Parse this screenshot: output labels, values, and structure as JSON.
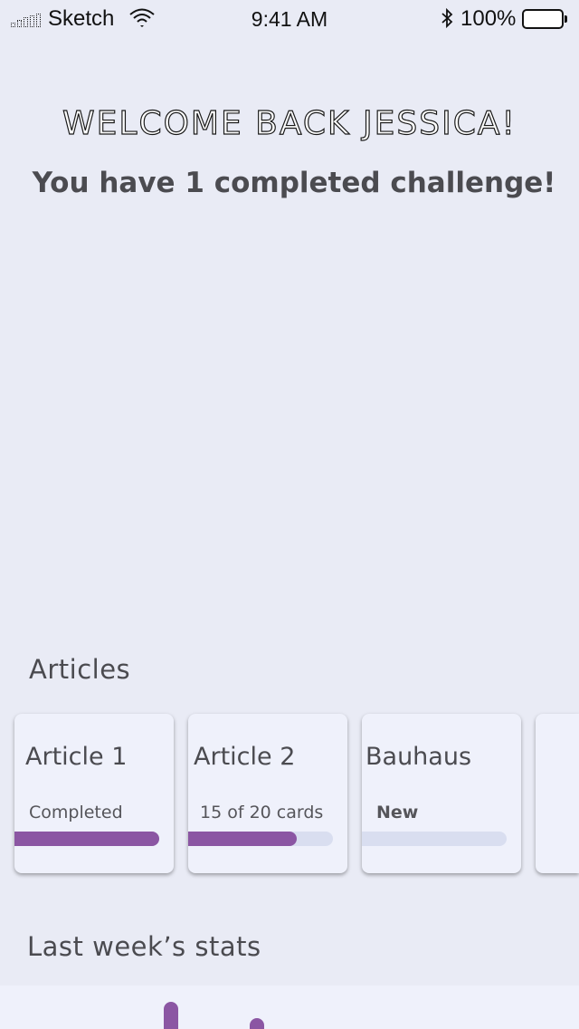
{
  "status_bar": {
    "carrier": "Sketch",
    "time": "9:41 AM",
    "battery": "100%"
  },
  "header": {
    "welcome": "WELCOME BACK JESSICA!",
    "subtitle": "You have 1 completed challenge!"
  },
  "articles": {
    "title": "Articles",
    "cards": [
      {
        "title": "Article 1",
        "status": "Completed",
        "progress": 1.0
      },
      {
        "title": "Article 2",
        "status": "15 of 20 cards",
        "progress": 0.75
      },
      {
        "title": "Bauhaus",
        "status": "New",
        "progress": 0.0
      }
    ]
  },
  "stats": {
    "title": "Last week’s stats"
  },
  "colors": {
    "accent": "#8b56a3",
    "background": "#e9ebf5",
    "card": "#eff1fb",
    "track": "#d9def0"
  }
}
